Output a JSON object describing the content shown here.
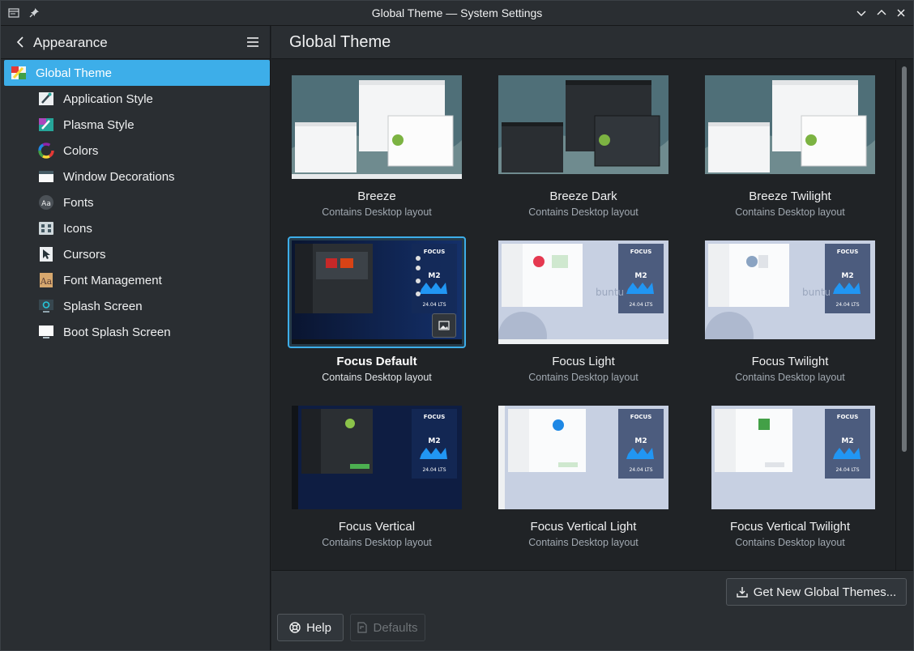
{
  "window": {
    "title": "Global Theme — System Settings"
  },
  "sidebar": {
    "header_title": "Appearance",
    "items": [
      {
        "label": "Global Theme",
        "icon": "global-theme-icon",
        "selected": true
      },
      {
        "label": "Application Style",
        "icon": "application-style-icon"
      },
      {
        "label": "Plasma Style",
        "icon": "plasma-style-icon"
      },
      {
        "label": "Colors",
        "icon": "colors-icon"
      },
      {
        "label": "Window Decorations",
        "icon": "window-decorations-icon"
      },
      {
        "label": "Fonts",
        "icon": "fonts-icon"
      },
      {
        "label": "Icons",
        "icon": "icons-icon"
      },
      {
        "label": "Cursors",
        "icon": "cursors-icon"
      },
      {
        "label": "Font Management",
        "icon": "font-management-icon"
      },
      {
        "label": "Splash Screen",
        "icon": "splash-screen-icon"
      },
      {
        "label": "Boot Splash Screen",
        "icon": "boot-splash-screen-icon"
      }
    ]
  },
  "main": {
    "title": "Global Theme",
    "themes": [
      {
        "name": "Breeze",
        "subtitle": "Contains Desktop layout",
        "style": "breeze-light"
      },
      {
        "name": "Breeze Dark",
        "subtitle": "Contains Desktop layout",
        "style": "breeze-dark"
      },
      {
        "name": "Breeze Twilight",
        "subtitle": "Contains Desktop layout",
        "style": "breeze-twilight"
      },
      {
        "name": "Focus Default",
        "subtitle": "Contains Desktop layout",
        "style": "focus-dark",
        "selected": true
      },
      {
        "name": "Focus Light",
        "subtitle": "Contains Desktop layout",
        "style": "focus-light"
      },
      {
        "name": "Focus Twilight",
        "subtitle": "Contains Desktop layout",
        "style": "focus-light"
      },
      {
        "name": "Focus Vertical",
        "subtitle": "Contains Desktop layout",
        "style": "focus-dark-vertical"
      },
      {
        "name": "Focus Vertical Light",
        "subtitle": "Contains Desktop layout",
        "style": "focus-light-vertical"
      },
      {
        "name": "Focus Vertical Twilight",
        "subtitle": "Contains Desktop layout",
        "style": "focus-light-vertical"
      }
    ],
    "preview_text": {
      "brand": "FOCUS",
      "model": "M2",
      "release": "24.04 LTS",
      "distro": "ubuntu"
    }
  },
  "footer": {
    "get_new_label": "Get New Global Themes...",
    "help_label": "Help",
    "defaults_label": "Defaults"
  },
  "colors": {
    "accent": "#3daee9",
    "window_bg": "#202326",
    "panel_bg": "#2a2e32"
  }
}
